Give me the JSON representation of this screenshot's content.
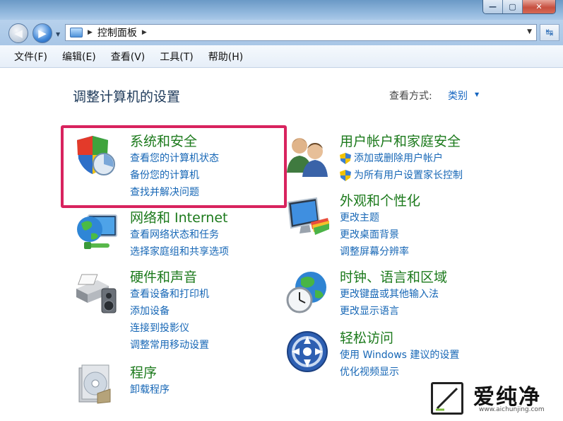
{
  "window": {
    "minimize": "—",
    "maximize": "▢",
    "close": "✕"
  },
  "address": {
    "path_item": "控制面板"
  },
  "menu": [
    "文件(F)",
    "编辑(E)",
    "查看(V)",
    "工具(T)",
    "帮助(H)"
  ],
  "page": {
    "title": "调整计算机的设置",
    "view_by_label": "查看方式:",
    "view_by_value": "类别"
  },
  "categories": {
    "system": {
      "title": "系统和安全",
      "links": [
        "查看您的计算机状态",
        "备份您的计算机",
        "查找并解决问题"
      ]
    },
    "network": {
      "title": "网络和 Internet",
      "links": [
        "查看网络状态和任务",
        "选择家庭组和共享选项"
      ]
    },
    "hardware": {
      "title": "硬件和声音",
      "links": [
        "查看设备和打印机",
        "添加设备",
        "连接到投影仪",
        "调整常用移动设置"
      ]
    },
    "programs": {
      "title": "程序",
      "links": [
        "卸载程序"
      ]
    },
    "users": {
      "title": "用户帐户和家庭安全",
      "links": [
        "添加或删除用户帐户",
        "为所有用户设置家长控制"
      ]
    },
    "appearance": {
      "title": "外观和个性化",
      "links": [
        "更改主题",
        "更改桌面背景",
        "调整屏幕分辨率"
      ]
    },
    "clock": {
      "title": "时钟、语言和区域",
      "links": [
        "更改键盘或其他输入法",
        "更改显示语言"
      ]
    },
    "ease": {
      "title": "轻松访问",
      "links": [
        "使用 Windows 建议的设置",
        "优化视频显示"
      ]
    }
  },
  "watermark": {
    "text": "爱纯净",
    "url": "www.aichunjing.com"
  },
  "colors": {
    "category_title": "#1c7a1c",
    "link": "#1767b6",
    "highlight": "#d8235e"
  }
}
